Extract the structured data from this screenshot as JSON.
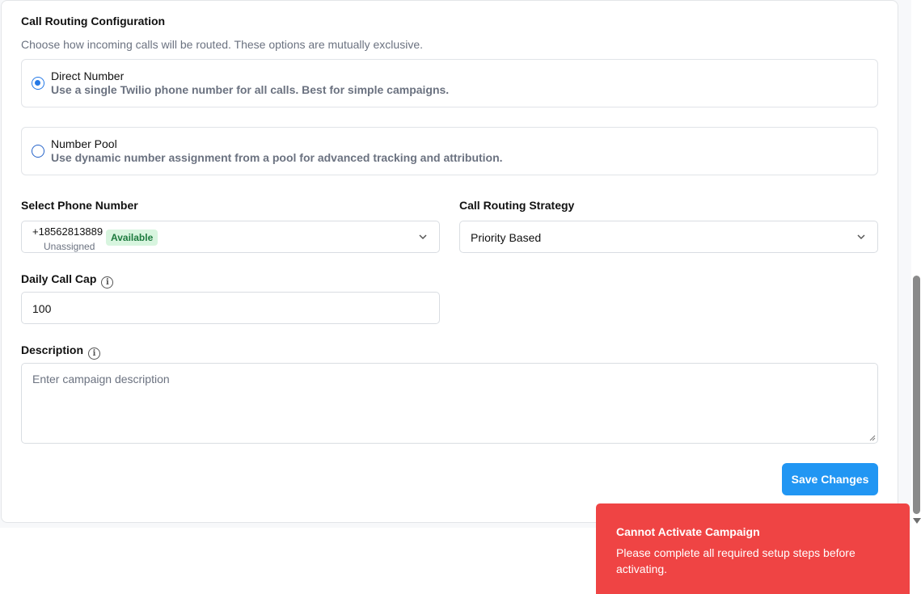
{
  "routing": {
    "title": "Call Routing Configuration",
    "subtitle": "Choose how incoming calls will be routed. These options are mutually exclusive.",
    "options": [
      {
        "title": "Direct Number",
        "description": "Use a single Twilio phone number for all calls. Best for simple campaigns.",
        "selected": true
      },
      {
        "title": "Number Pool",
        "description": "Use dynamic number assignment from a pool for advanced tracking and attribution.",
        "selected": false
      }
    ]
  },
  "phone": {
    "label": "Select Phone Number",
    "number": "+18562813889",
    "status": "Unassigned",
    "badge": "Available"
  },
  "strategy": {
    "label": "Call Routing Strategy",
    "value": "Priority Based"
  },
  "daily_cap": {
    "label": "Daily Call Cap",
    "value": "100"
  },
  "description": {
    "label": "Description",
    "placeholder": "Enter campaign description",
    "value": ""
  },
  "save_label": "Save Changes",
  "toast": {
    "title": "Cannot Activate Campaign",
    "message": "Please complete all required setup steps before activating."
  },
  "colors": {
    "primary": "#2196f3",
    "error": "#ef4444",
    "badge_bg": "#d8f5df",
    "badge_text": "#1d7a3e"
  }
}
